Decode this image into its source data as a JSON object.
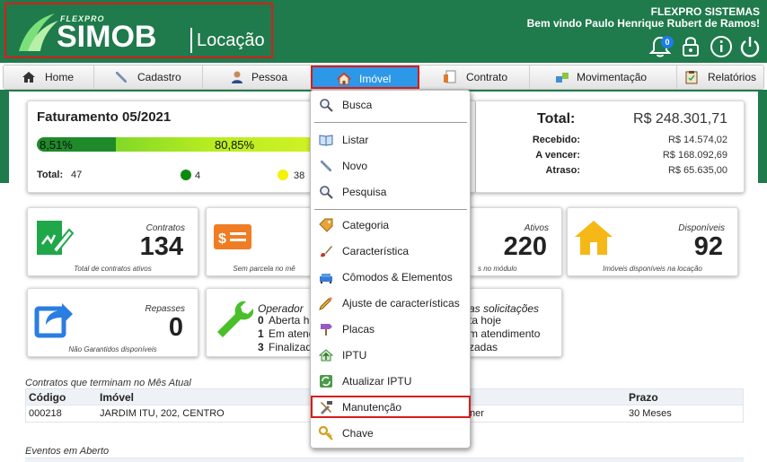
{
  "header": {
    "logo_small": "FLEXPRO",
    "logo_main": "SIMOB",
    "logo_sub": "Locação",
    "company": "FLEXPRO SISTEMAS",
    "welcome": "Bem vindo Paulo Henrique Rubert de Ramos!",
    "notification_count": "0"
  },
  "nav": {
    "home": "Home",
    "cadastro": "Cadastro",
    "pessoa": "Pessoa",
    "imovel": "Imóvel",
    "contrato": "Contrato",
    "movimentacao": "Movimentação",
    "relatorios": "Relatórios"
  },
  "faturamento": {
    "title": "Faturamento 05/2021",
    "pct_green": "8,51%",
    "pct_yellow": "80,85%",
    "green_fraction": 0.0851,
    "total_label": "Total:",
    "total_value": "47",
    "green_count": "4",
    "yellow_count": "38"
  },
  "totais": {
    "total_label": "Total:",
    "total_value": "R$ 248.301,71",
    "recebido_label": "Recebido:",
    "recebido_value": "R$ 14.574,02",
    "avencer_label": "A vencer:",
    "avencer_value": "R$ 168.092,69",
    "atraso_label": "Atraso:",
    "atraso_value": "R$ 65.635,00"
  },
  "cards": {
    "contratos": {
      "label": "Contratos",
      "value": "134",
      "sub": "Total de contratos ativos"
    },
    "sem_parcela": {
      "sub": "Sem parcela no mê"
    },
    "ativos": {
      "label": "Ativos",
      "value": "220",
      "sub": "s no módulo"
    },
    "disponiveis": {
      "label": "Disponíveis",
      "value": "92",
      "sub": "Imóveis disponíveis na locação"
    },
    "repasses": {
      "label": "Repasses",
      "value": "0",
      "sub": "Não Garantidos disponíveis"
    },
    "operador": {
      "title": "Operador",
      "lines": [
        {
          "n": "0",
          "t": "Aberta h"
        },
        {
          "n": "1",
          "t": "Em atend"
        },
        {
          "n": "3",
          "t": "Finalizad"
        }
      ]
    },
    "solicitacoes": {
      "title": "as solicitações",
      "lines": [
        "ta hoje",
        "m atendimento",
        "zadas"
      ]
    }
  },
  "contratos_mes": {
    "title": "Contratos que terminam no Mês Atual",
    "headers": {
      "codigo": "Código",
      "imovel": "Imóvel",
      "prazo": "Prazo"
    },
    "row": {
      "codigo": "000218",
      "imovel": "JARDIM ITU, 202, CENTRO",
      "mid": "ner",
      "prazo": "30 Meses"
    }
  },
  "eventos": {
    "title": "Eventos em Aberto"
  },
  "dropdown": {
    "items": [
      {
        "label": "Busca",
        "icon": "magnifier-icon"
      },
      {
        "label": "Listar",
        "icon": "book-icon"
      },
      {
        "label": "Novo",
        "icon": "pen-icon"
      },
      {
        "label": "Pesquisa",
        "icon": "magnifier-icon"
      },
      {
        "label": "Categoria",
        "icon": "tag-icon"
      },
      {
        "label": "Característica",
        "icon": "brush-icon"
      },
      {
        "label": "Cômodos & Elementos",
        "icon": "sofa-icon"
      },
      {
        "label": "Ajuste de características",
        "icon": "pencil-icon"
      },
      {
        "label": "Placas",
        "icon": "sign-icon"
      },
      {
        "label": "IPTU",
        "icon": "house-up-icon"
      },
      {
        "label": "Atualizar IPTU",
        "icon": "refresh-icon"
      },
      {
        "label": "Manutenção",
        "icon": "tools-icon"
      },
      {
        "label": "Chave",
        "icon": "key-icon"
      }
    ]
  }
}
